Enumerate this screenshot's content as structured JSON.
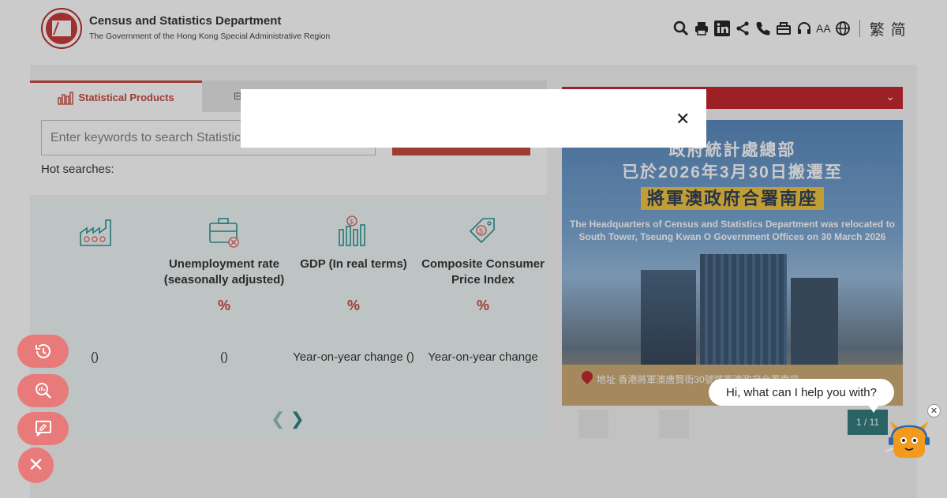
{
  "header": {
    "dept_title": "Census and Statistics Department",
    "dept_subtitle": "The Government of the Hong Kong Special Administrative Region",
    "font_size_label": "AA",
    "lang_trad": "繁",
    "lang_simp": "简"
  },
  "tabs": [
    {
      "label": "Statistical Products",
      "active": true
    },
    {
      "label": "",
      "active": false
    }
  ],
  "search": {
    "placeholder": "Enter keywords to search Statistical",
    "hot_searches_label": "Hot searches:"
  },
  "stats": [
    {
      "icon": "factory-icon",
      "label": "",
      "unit": "",
      "change": "()"
    },
    {
      "icon": "briefcase-icon",
      "label": "Unemployment rate (seasonally adjusted)",
      "unit": "%",
      "change": "()"
    },
    {
      "icon": "dollar-chart-icon",
      "label": "GDP (In real terms)",
      "unit": "%",
      "change": "Year-on-year change ()"
    },
    {
      "icon": "price-tag-icon",
      "label": "Composite Consumer Price Index",
      "unit": "%",
      "change": "Year-on-year change"
    }
  ],
  "banner": {
    "line1": "政府統計處總部",
    "line2": "已於2026年3月30日搬遷至",
    "line3": "將軍澳政府合署南座",
    "english": "The Headquarters of Census and Statistics Department was relocated to South Tower, Tseung Kwan O Government Offices on 30 March 2026",
    "address": "地址  香港將軍澳唐賢街30號將軍澳政府合署南座"
  },
  "pager": "1 / 11",
  "chat": {
    "greeting": "Hi, what can I help you with?"
  },
  "colors": {
    "brand_red": "#c0392b",
    "teal": "#1f6f6f",
    "fab": "#e97a7a"
  }
}
